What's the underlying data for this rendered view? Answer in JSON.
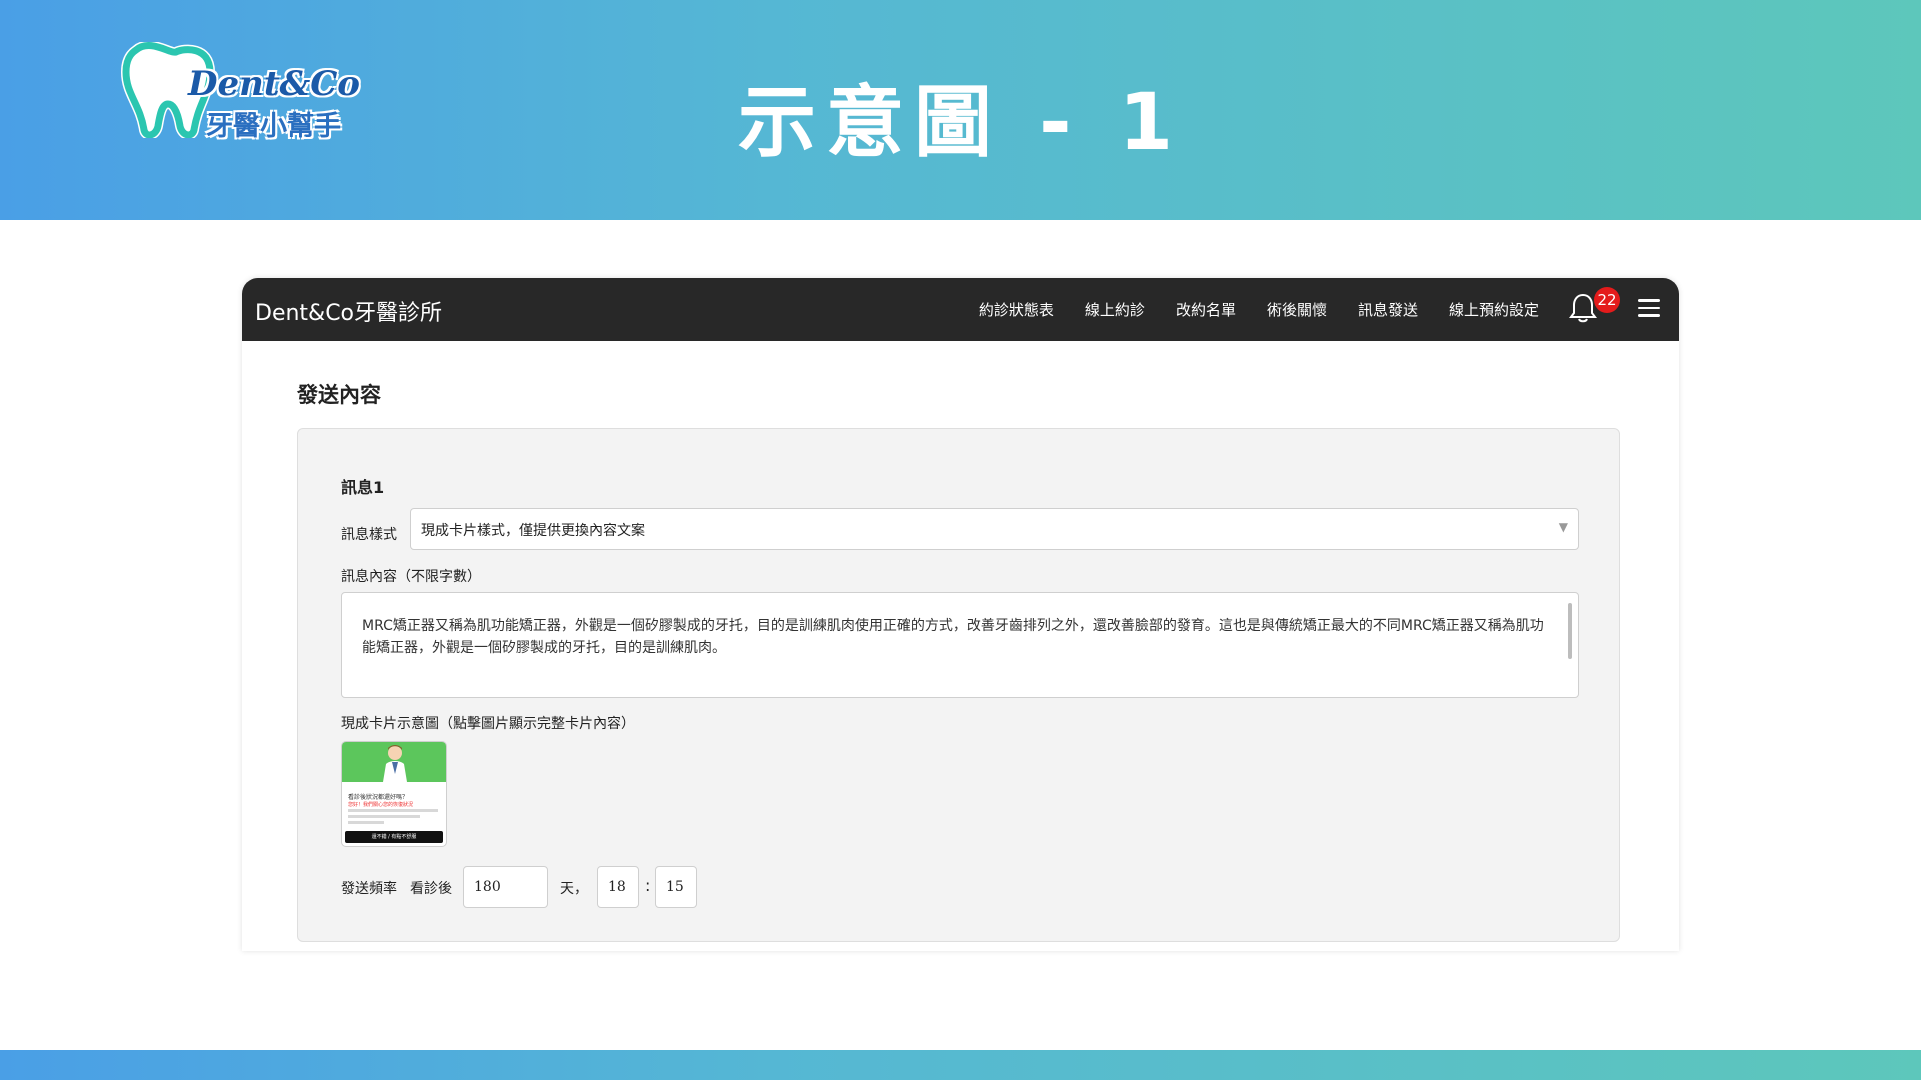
{
  "banner": {
    "title": "示意圖 - 1",
    "logo_text_en": "Dent&Co",
    "logo_text_zh": "牙醫小幫手"
  },
  "navbar": {
    "brand": "Dent&Co牙醫診所",
    "items": [
      "約診狀態表",
      "線上約診",
      "改約名單",
      "術後關懷",
      "訊息發送",
      "線上預約設定"
    ],
    "notification_count": "22"
  },
  "form": {
    "section_title": "發送內容",
    "message_title": "訊息1",
    "style_label": "訊息樣式",
    "style_value": "現成卡片樣式，僅提供更換內容文案",
    "content_label": "訊息內容（不限字數）",
    "content_value": "MRC矯正器又稱為肌功能矯正器，外觀是一個矽膠製成的牙托，目的是訓練肌肉使用正確的方式，改善牙齒排列之外，還改善臉部的發育。這也是與傳統矯正最大的不同MRC矯正器又稱為肌功能矯正器，外觀是一個矽膠製成的牙托，目的是訓練肌肉。",
    "preview_label": "現成卡片示意圖（點擊圖片顯示完整卡片內容）",
    "card": {
      "heading": "看診後狀況都還好嗎？",
      "highlight": "您好！我們關心您的恢復狀況",
      "button": "還不錯 / 有點不舒服"
    },
    "frequency_label": "發送頻率",
    "after_visit_label": "看診後",
    "days_value": "180",
    "days_unit": "天，",
    "hour_value": "18",
    "separator": ":",
    "minute_value": "15"
  },
  "colors": {
    "banner_start": "#4a9fe6",
    "banner_end": "#5dc7bb",
    "navbar": "#282828",
    "badge": "#e41b1b"
  },
  "icons": {
    "bell": "bell-icon",
    "menu": "hamburger-menu-icon",
    "select_arrow": "caret-down-icon"
  }
}
